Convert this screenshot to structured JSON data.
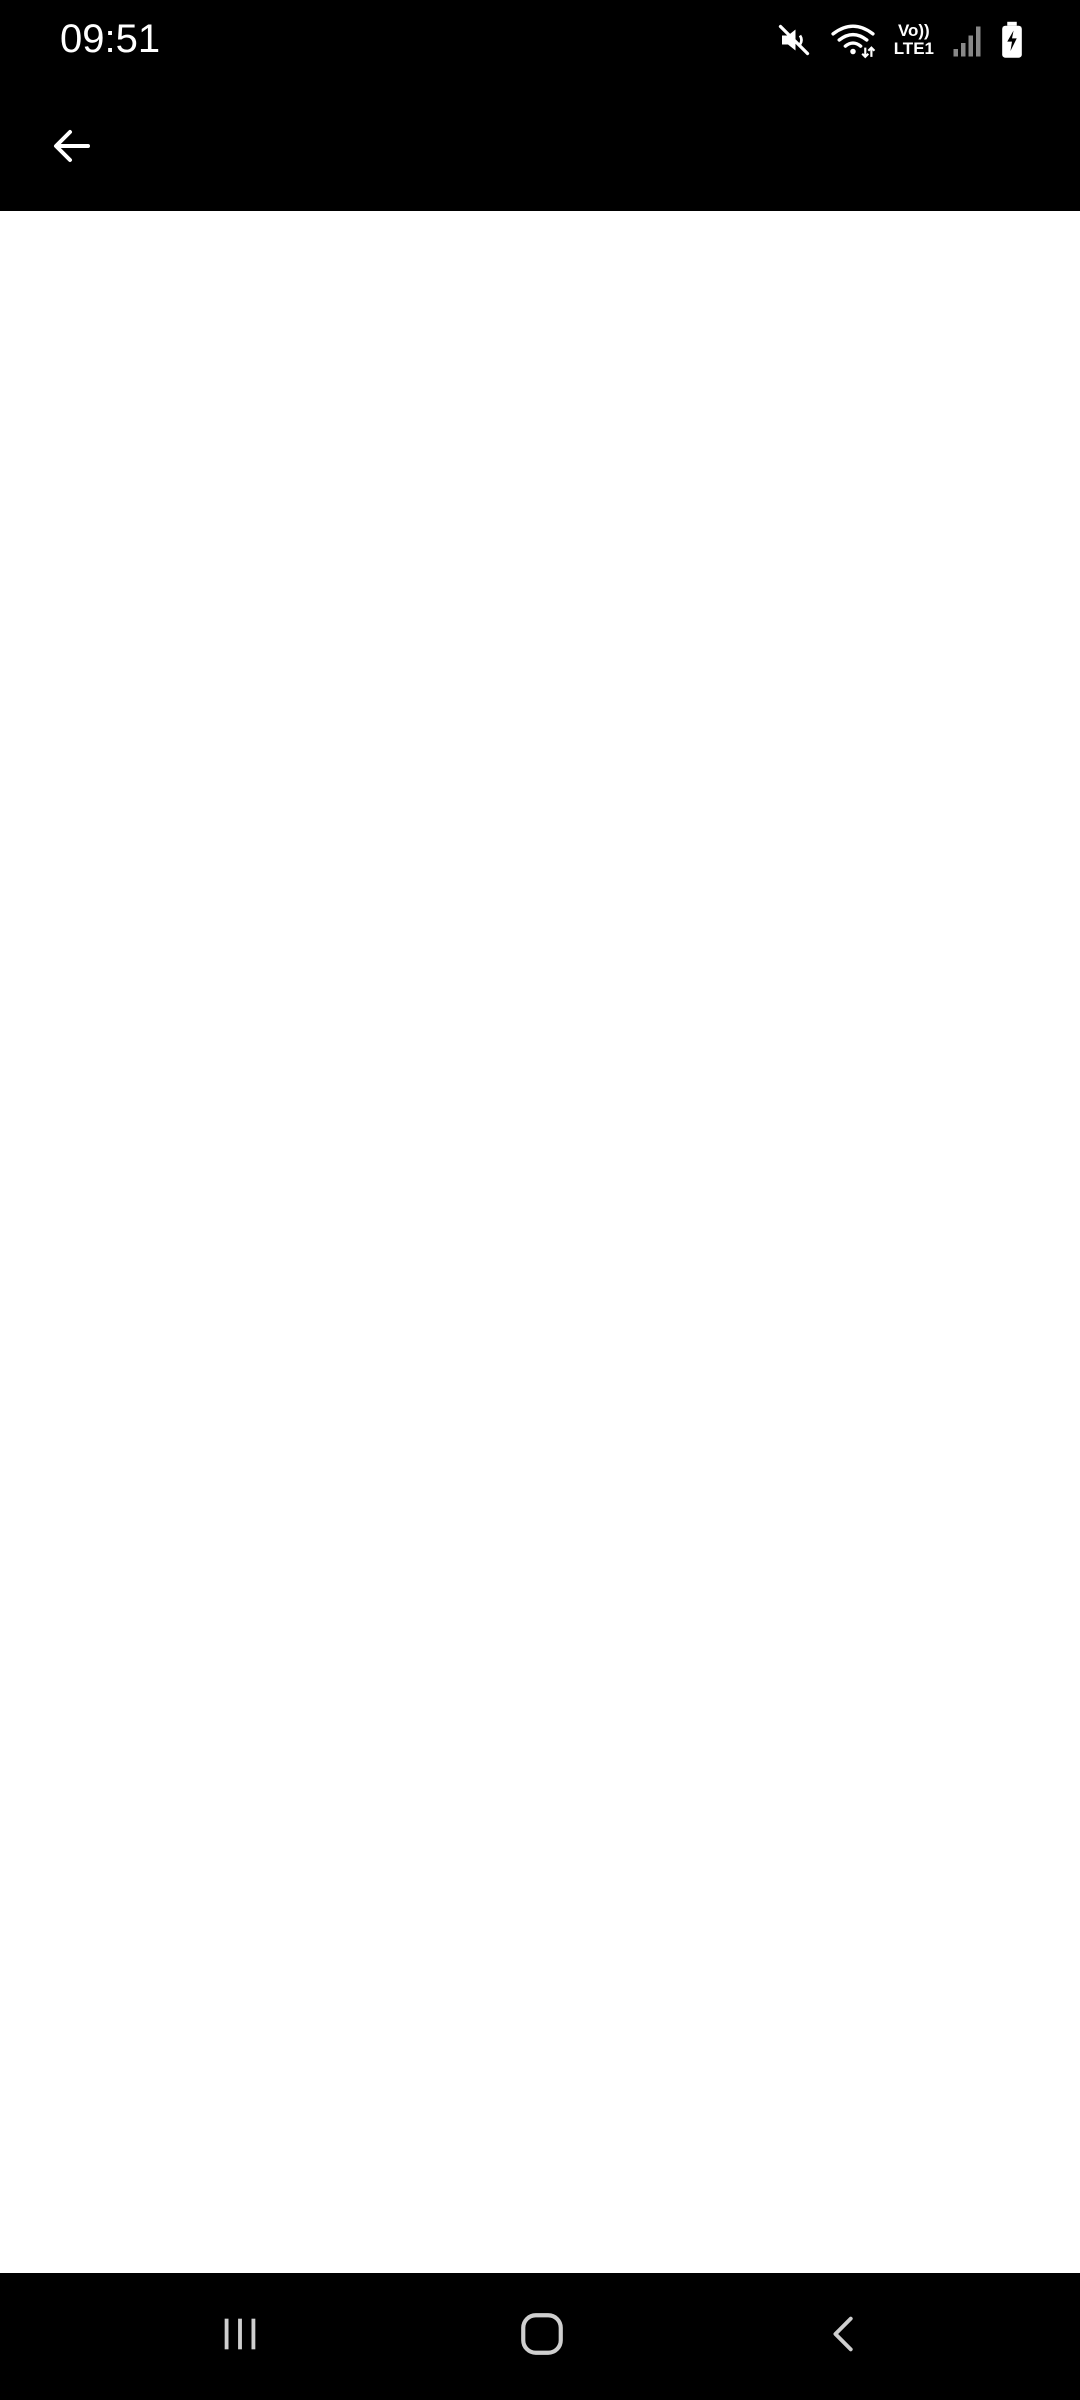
{
  "status_bar": {
    "time": "09:51",
    "icons": [
      "mute-icon",
      "wifi-icon",
      "volte-icon",
      "signal-icon",
      "battery-charging-icon"
    ],
    "volte_top": "Vo))",
    "volte_bottom": "LTE1"
  },
  "app_bar": {
    "back_icon": "arrow-left-icon",
    "background": "#000000"
  },
  "content": {
    "background": "#ffffff"
  },
  "nav_bar": {
    "buttons": [
      "recents-icon",
      "home-icon",
      "back-chevron-icon"
    ],
    "background": "#000000"
  }
}
